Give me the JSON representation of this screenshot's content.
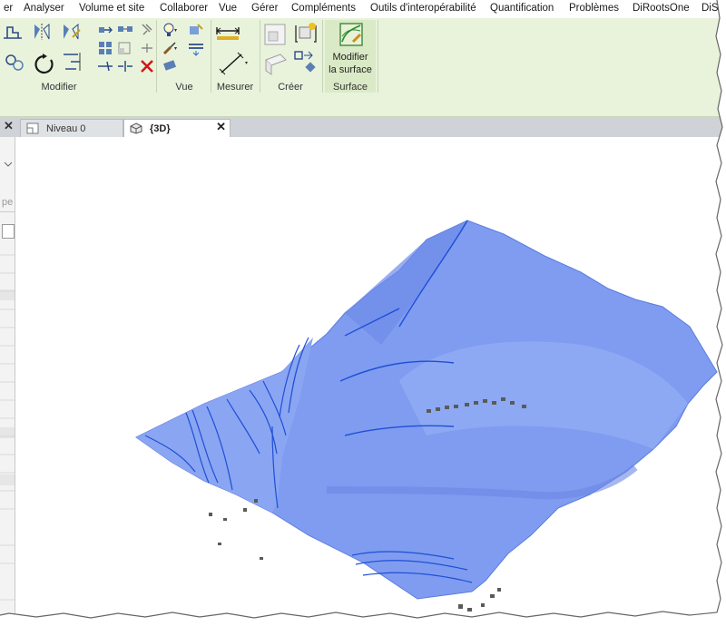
{
  "menu": {
    "items": [
      "er",
      "Analyser",
      "Volume et site",
      "Collaborer",
      "Vue",
      "Gérer",
      "Compléments",
      "Outils d'interopérabilité",
      "Quantification",
      "Problèmes",
      "DiRootsOne",
      "DiSt"
    ]
  },
  "ribbon": {
    "panels": {
      "modifier": "Modifier",
      "vue": "Vue",
      "mesurer": "Mesurer",
      "creer": "Créer",
      "surface": "Surface"
    },
    "modify_surface_line1": "Modifier",
    "modify_surface_line2": "la surface"
  },
  "tabs": {
    "tab1": "Niveau 0",
    "tab2": "{3D}",
    "close_glyph": "✕"
  },
  "left_panel": {
    "fragment": "pe"
  },
  "colors": {
    "ribbon_bg": "#e9f3dc",
    "terrain_fill": "#7f9cf0",
    "terrain_line": "#1f4fd6"
  }
}
